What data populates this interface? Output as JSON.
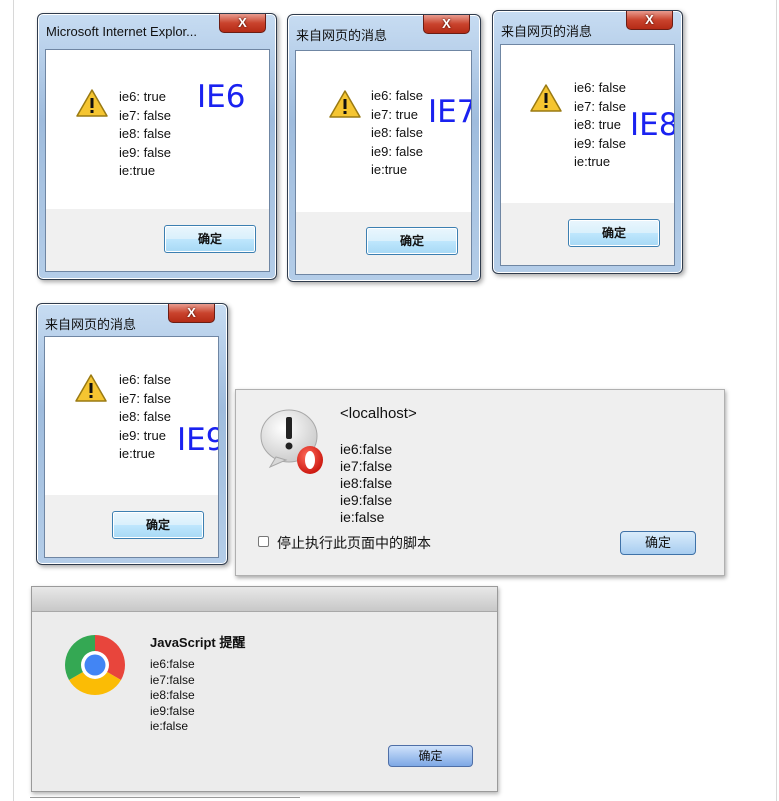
{
  "dialogs": {
    "ie6": {
      "title": "Microsoft Internet Explor...",
      "close": "X",
      "lines": [
        "ie6: true",
        "ie7: false",
        "ie8: false",
        "ie9: false",
        "ie:true"
      ],
      "label": "IE6",
      "ok": "确定"
    },
    "ie7": {
      "title": "来自网页的消息",
      "close": "X",
      "lines": [
        "ie6: false",
        "ie7: true",
        "ie8: false",
        "ie9: false",
        "ie:true"
      ],
      "label": "IE7",
      "ok": "确定"
    },
    "ie8": {
      "title": "来自网页的消息",
      "close": "X",
      "lines": [
        "ie6: false",
        "ie7: false",
        "ie8: true",
        "ie9: false",
        "ie:true"
      ],
      "label": "IE8",
      "ok": "确定"
    },
    "ie9": {
      "title": "来自网页的消息",
      "close": "X",
      "lines": [
        "ie6: false",
        "ie7: false",
        "ie8: false",
        "ie9: true",
        "ie:true"
      ],
      "label": "IE9",
      "ok": "确定"
    }
  },
  "opera": {
    "title": "<localhost>",
    "lines": [
      "ie6:false",
      "ie7:false",
      "ie8:false",
      "ie9:false",
      "ie:false"
    ],
    "checkbox_label": "停止执行此页面中的脚本",
    "checkbox_checked": false,
    "ok": "确定"
  },
  "chrome": {
    "title": "JavaScript 提醒",
    "lines": [
      "ie6:false",
      "ie7:false",
      "ie8:false",
      "ie9:false",
      "ie:false"
    ],
    "ok": "确定"
  },
  "icons": {
    "warning": "warning-icon",
    "opera": "opera-alert-icon",
    "chrome": "chrome-logo-icon"
  },
  "colors": {
    "ie_label": "#1a22f0",
    "close_button": "#c9432d"
  }
}
